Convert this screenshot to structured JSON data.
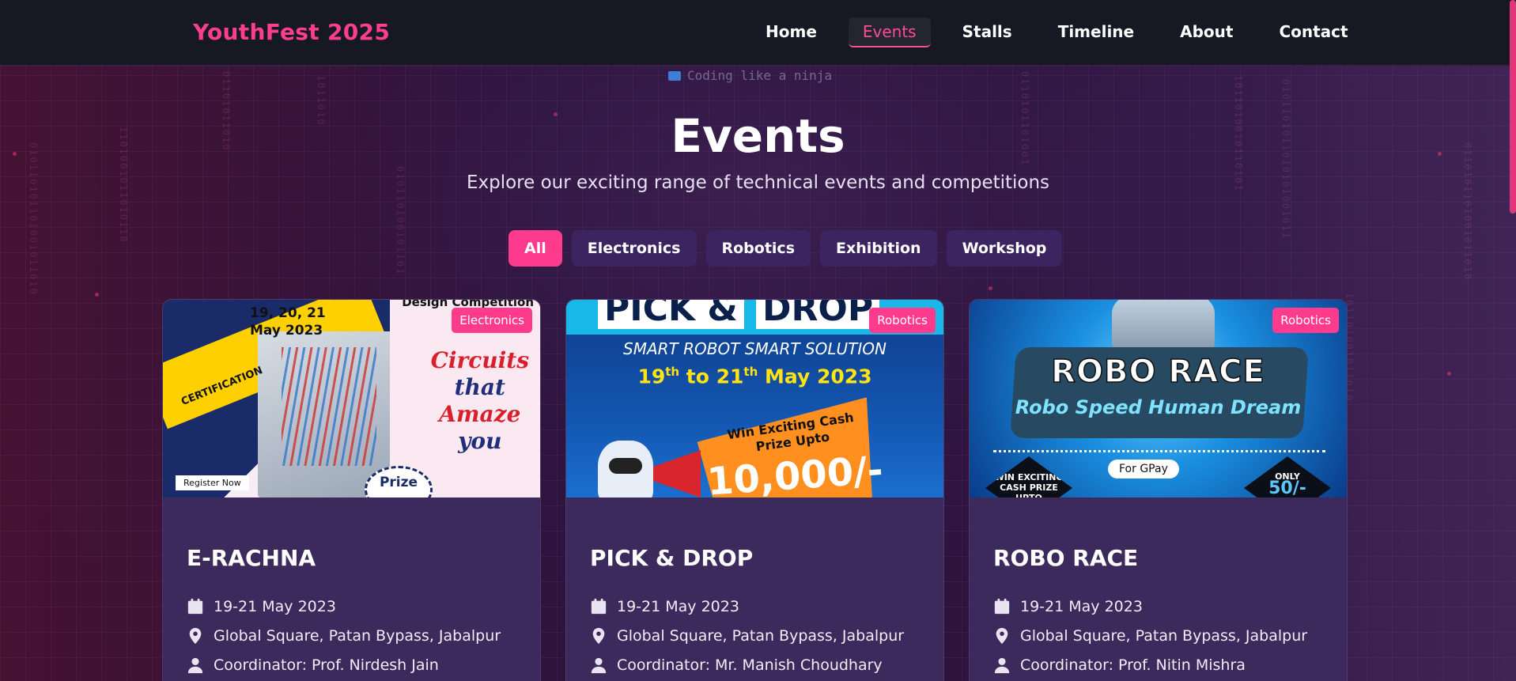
{
  "nav": {
    "brand": "YouthFest 2025",
    "links": [
      "Home",
      "Events",
      "Stalls",
      "Timeline",
      "About",
      "Contact"
    ],
    "active_link": "Events"
  },
  "typing_text": "Coding like a ninja",
  "header": {
    "title": "Events",
    "subtitle": "Explore our exciting range of technical events and competitions"
  },
  "filters": [
    "All",
    "Electronics",
    "Robotics",
    "Exhibition",
    "Workshop"
  ],
  "active_filter": "All",
  "events": [
    {
      "title": "E-RACHNA",
      "category": "Electronics",
      "date": "19-21 May 2023",
      "venue": "Global Square, Patan Bypass, Jabalpur",
      "coordinator": "Coordinator: Prof. Nirdesh Jain",
      "poster": {
        "dates_line1": "19, 20, 21",
        "dates_line2": "May 2023",
        "heading": "Design Competition",
        "ribbon": "CERTIFICATION",
        "slogan_1": "Circuits",
        "slogan_2": "that",
        "slogan_3": "Amaze",
        "slogan_4": "you",
        "register": "Register Now",
        "prize": "Prize"
      }
    },
    {
      "title": "PICK & DROP",
      "category": "Robotics",
      "date": "19-21 May 2023",
      "venue": "Global Square, Patan Bypass, Jabalpur",
      "coordinator": "Coordinator: Mr. Manish Choudhary",
      "poster": {
        "title_a": "PICK &",
        "title_b": "DROP",
        "tagline": "SMART ROBOT SMART SOLUTION",
        "date_a": "19",
        "date_a_sup": "th",
        "date_mid": " to 21",
        "date_b_sup": "th",
        "date_end": " May 2023",
        "cash": "Win Exciting Cash Prize Upto",
        "amount": "10,000/-"
      }
    },
    {
      "title": "ROBO RACE",
      "category": "Robotics",
      "date": "19-21 May 2023",
      "venue": "Global Square, Patan Bypass, Jabalpur",
      "coordinator": "Coordinator: Prof. Nitin Mishra",
      "poster": {
        "title": "ROBO RACE",
        "tagline": "Robo Speed Human Dream",
        "win": "WIN EXCITING CASH PRIZE UPTO",
        "gpay": "For GPay",
        "only": "ONLY",
        "fee": "50/-"
      }
    }
  ],
  "colors": {
    "accent": "#ff3b8d",
    "nav_bg": "#161824",
    "card_bg": "#3d2a5c",
    "filter_bg": "#3b2460"
  }
}
